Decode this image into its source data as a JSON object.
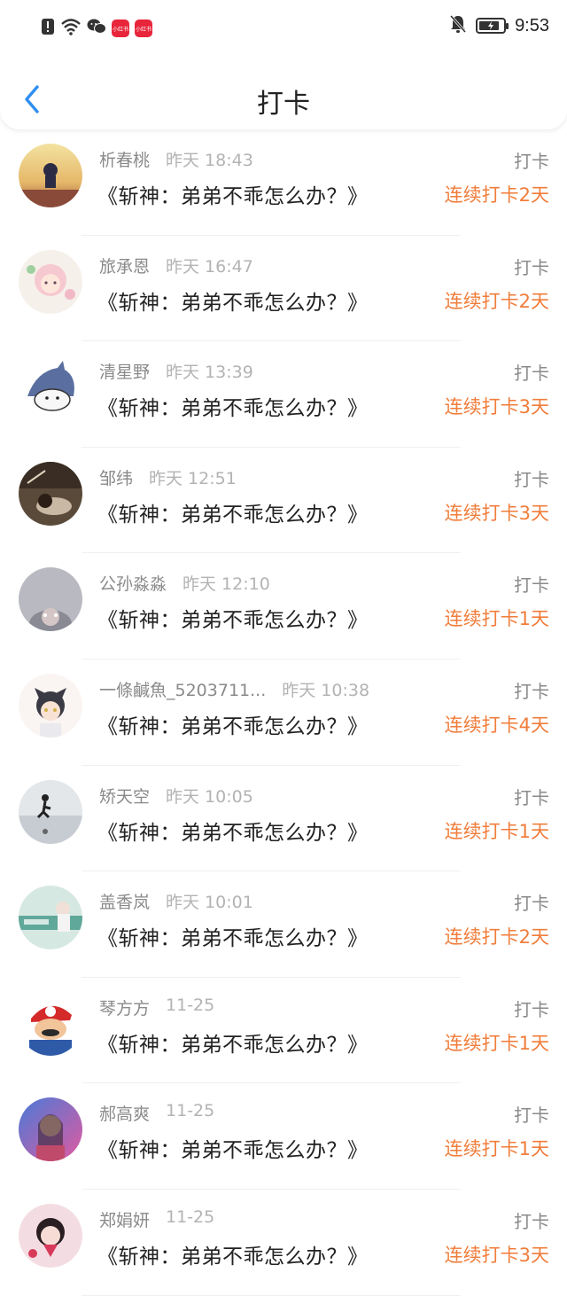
{
  "status_bar": {
    "time": "9:53",
    "app_badges": [
      "小红书",
      "小红书"
    ],
    "battery_level": 0.85
  },
  "header": {
    "title": "打卡"
  },
  "colors": {
    "accent_orange": "#f07d3b",
    "back_blue": "#2f8ff0",
    "muted_text": "#8a8a8a"
  },
  "entries": [
    {
      "name": "析春桃",
      "time": "昨天 18:43",
      "book": "《斩神：弟弟不乖怎么办？》",
      "tag": "打卡",
      "streak": "连续打卡2天",
      "avatar": "sunset-silhouette-avatar"
    },
    {
      "name": "旅承恩",
      "time": "昨天 16:47",
      "book": "《斩神：弟弟不乖怎么办？》",
      "tag": "打卡",
      "streak": "连续打卡2天",
      "avatar": "pink-hair-girl-avatar"
    },
    {
      "name": "清星野",
      "time": "昨天 13:39",
      "book": "《斩神：弟弟不乖怎么办？》",
      "tag": "打卡",
      "streak": "连续打卡3天",
      "avatar": "shark-cartoon-avatar"
    },
    {
      "name": "邹纬",
      "time": "昨天 12:51",
      "book": "《斩神：弟弟不乖怎么办？》",
      "tag": "打卡",
      "streak": "连续打卡3天",
      "avatar": "dark-room-avatar"
    },
    {
      "name": "公孙淼淼",
      "time": "昨天 12:10",
      "book": "《斩神：弟弟不乖怎么办？》",
      "tag": "打卡",
      "streak": "连续打卡1天",
      "avatar": "grey-face-avatar"
    },
    {
      "name": "一條鹹魚_5203711...",
      "time": "昨天 10:38",
      "book": "《斩神：弟弟不乖怎么办？》",
      "tag": "打卡",
      "streak": "连续打卡4天",
      "avatar": "cat-ear-boy-avatar"
    },
    {
      "name": "矫天空",
      "time": "昨天 10:05",
      "book": "《斩神：弟弟不乖怎么办？》",
      "tag": "打卡",
      "streak": "连续打卡1天",
      "avatar": "runner-reflection-avatar"
    },
    {
      "name": "盖香岚",
      "time": "昨天 10:01",
      "book": "《斩神：弟弟不乖怎么办？》",
      "tag": "打卡",
      "streak": "连续打卡2天",
      "avatar": "green-photo-avatar"
    },
    {
      "name": "琴方方",
      "time": "11-25",
      "book": "《斩神：弟弟不乖怎么办？》",
      "tag": "打卡",
      "streak": "连续打卡1天",
      "avatar": "mario-cartoon-avatar"
    },
    {
      "name": "郝高爽",
      "time": "11-25",
      "book": "《斩神：弟弟不乖怎么办？》",
      "tag": "打卡",
      "streak": "连续打卡1天",
      "avatar": "neon-girl-avatar"
    },
    {
      "name": "郑娟妍",
      "time": "11-25",
      "book": "《斩神：弟弟不乖怎么办？》",
      "tag": "打卡",
      "streak": "连续打卡3天",
      "avatar": "pink-girl-avatar"
    }
  ]
}
